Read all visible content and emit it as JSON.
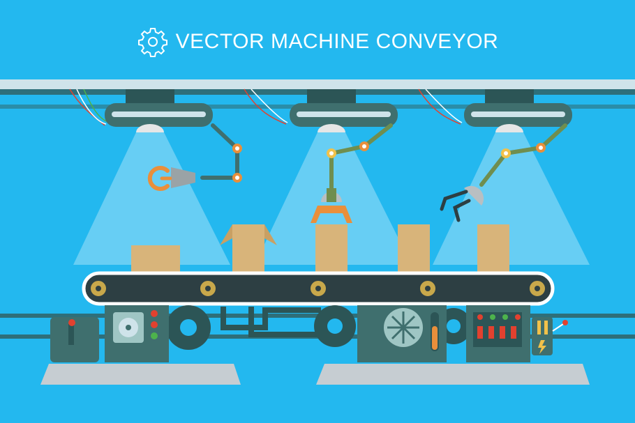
{
  "title": {
    "text": "VECTOR MACHINE CONVEYOR",
    "icon": "gear-outline-icon"
  },
  "colors": {
    "background": "#23b8ef",
    "rail": "#2e6f7a",
    "machine_body": "#3f6f6e",
    "machine_dark": "#2c5556",
    "box": "#d8b47a",
    "box_side": "#c9a063",
    "belt": "#2d3f43",
    "belt_border": "#ffffff",
    "gear": "#c8a84b",
    "light_beam": "#e9f6ff",
    "arm_joint": "#e98f3b",
    "arm": "#6f8e4f",
    "floor": "#c6cdd2"
  },
  "lamps": [
    {
      "on": true
    },
    {
      "on": true
    },
    {
      "on": true
    }
  ],
  "indicator_lights": [
    "#e2412f",
    "#e2412f",
    "#4db34c"
  ],
  "boxes_count": 5,
  "belt_rollers": 5
}
